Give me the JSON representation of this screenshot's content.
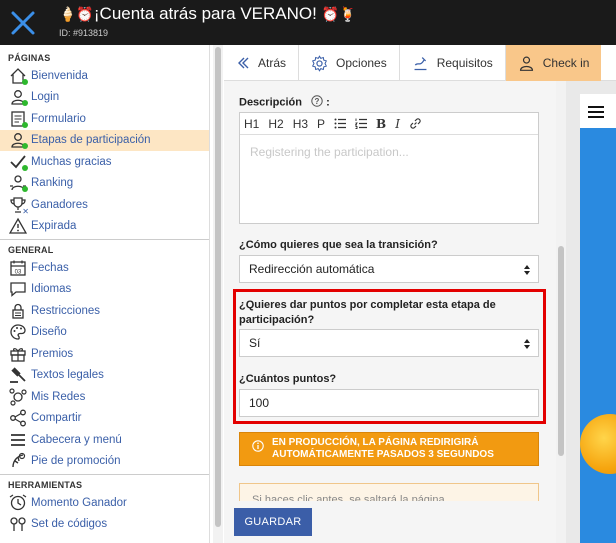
{
  "header": {
    "title_emoji_left": "🍦⏰",
    "title": "¡Cuenta atrás para VERANO!",
    "title_emoji_right": "⏰🍹",
    "id_label": "ID: #913819"
  },
  "sidebar": {
    "sections": [
      {
        "title": "PÁGINAS",
        "items": [
          {
            "label": "Bienvenida",
            "icon": "home-icon",
            "dot": true
          },
          {
            "label": "Login",
            "icon": "user-icon",
            "dot": true
          },
          {
            "label": "Formulario",
            "icon": "form-icon",
            "dot": true
          },
          {
            "label": "Etapas de participación",
            "icon": "user-icon",
            "dot": true,
            "active": true
          },
          {
            "label": "Muchas gracias",
            "icon": "check-icon",
            "dot": true
          },
          {
            "label": "Ranking",
            "icon": "ranking-icon",
            "dot": true
          },
          {
            "label": "Ganadores",
            "icon": "trophy-icon",
            "dot": false,
            "x": true
          },
          {
            "label": "Expirada",
            "icon": "warning-icon",
            "dot": false
          }
        ]
      },
      {
        "title": "GENERAL",
        "items": [
          {
            "label": "Fechas",
            "icon": "calendar-icon"
          },
          {
            "label": "Idiomas",
            "icon": "chat-icon"
          },
          {
            "label": "Restricciones",
            "icon": "lock-icon"
          },
          {
            "label": "Diseño",
            "icon": "palette-icon"
          },
          {
            "label": "Premios",
            "icon": "gift-icon"
          },
          {
            "label": "Textos legales",
            "icon": "gavel-icon"
          },
          {
            "label": "Mis Redes",
            "icon": "network-icon"
          },
          {
            "label": "Compartir",
            "icon": "share-icon"
          },
          {
            "label": "Cabecera y menú",
            "icon": "menu-icon"
          },
          {
            "label": "Pie de promoción",
            "icon": "footer-icon"
          }
        ]
      },
      {
        "title": "HERRAMIENTAS",
        "items": [
          {
            "label": "Momento Ganador",
            "icon": "clock-icon"
          },
          {
            "label": "Set de códigos",
            "icon": "codes-icon"
          }
        ]
      }
    ]
  },
  "tabs": [
    {
      "label": "Atrás",
      "icon": "back-icon"
    },
    {
      "label": "Opciones",
      "icon": "gear-icon"
    },
    {
      "label": "Requisitos",
      "icon": "requirements-icon"
    },
    {
      "label": "Check in",
      "icon": "checkin-icon",
      "active": true
    }
  ],
  "form": {
    "description_label": "Descripción",
    "description_suffix": ":",
    "toolbar": [
      "H1",
      "H2",
      "H3",
      "P"
    ],
    "description_placeholder": "Registering the participation...",
    "transition_label": "¿Cómo quieres que sea la transición?",
    "transition_value": "Redirección automática",
    "points_question_line1": "¿Quieres dar puntos por completar esta etapa de",
    "points_question_line2": "participación?",
    "points_answer": "Sí",
    "points_count_label": "¿Cuántos puntos?",
    "points_count_value": "100",
    "notice_line1": "EN PRODUCCIÓN, LA PÁGINA REDIRIGIRÁ",
    "notice_line2": "AUTOMÁTICAMENTE PASADOS 3 SEGUNDOS",
    "note2_text": "Si haces clic antes, se saltará la página",
    "save_label": "GUARDAR"
  },
  "colors": {
    "topbar": "#1a1a1a",
    "active_item": "#fde6c4",
    "active_tab": "#f9c78a",
    "link": "#3a5fa8",
    "status_dot": "#2eb82e",
    "highlight_border": "#e30000",
    "notice": "#f29a11",
    "save_button": "#3b5ea8"
  }
}
